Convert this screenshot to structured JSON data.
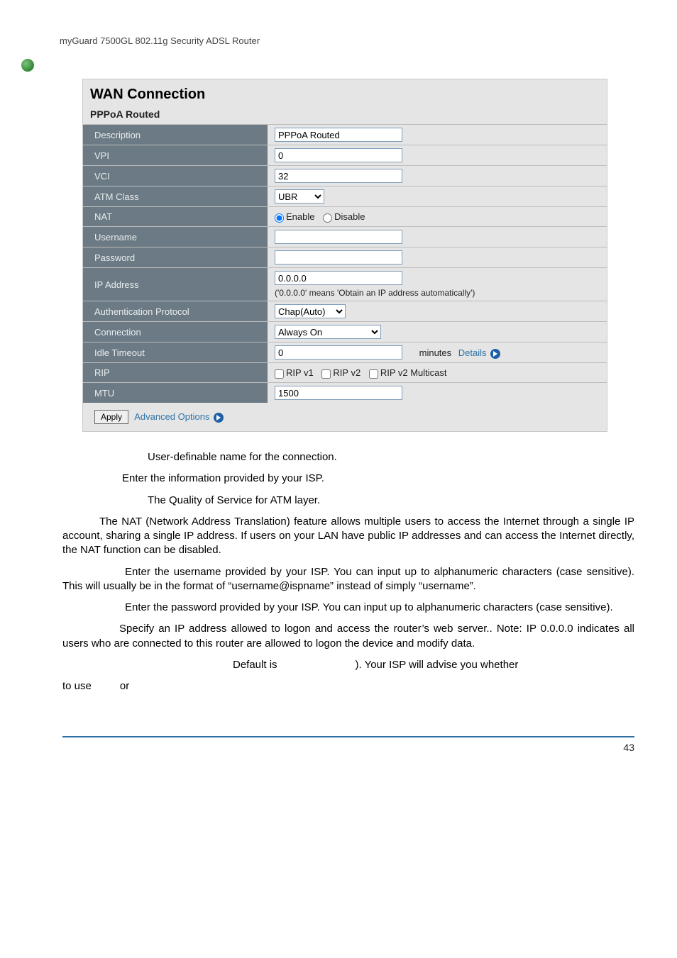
{
  "doc": {
    "header": "myGuard 7500GL 802.11g Security ADSL Router",
    "page_number": "43"
  },
  "panel": {
    "title": "WAN Connection",
    "subtitle": "PPPoA Routed",
    "labels": {
      "description": "Description",
      "vpi": "VPI",
      "vci": "VCI",
      "atm_class": "ATM Class",
      "nat": "NAT",
      "username": "Username",
      "password": "Password",
      "ip_address": "IP Address",
      "auth_protocol": "Authentication Protocol",
      "connection": "Connection",
      "idle_timeout": "Idle Timeout",
      "rip": "RIP",
      "mtu": "MTU"
    },
    "values": {
      "description": "PPPoA Routed",
      "vpi": "0",
      "vci": "32",
      "atm_class_selected": "UBR",
      "nat_enable": "Enable",
      "nat_disable": "Disable",
      "username": "",
      "password": "",
      "ip_address": "0.0.0.0",
      "ip_note": "('0.0.0.0' means 'Obtain an IP address automatically')",
      "auth_protocol_selected": "Chap(Auto)",
      "connection_selected": "Always On",
      "idle_timeout": "0",
      "idle_minutes": "minutes",
      "idle_details": "Details",
      "rip_v1": "RIP v1",
      "rip_v2": "RIP v2",
      "rip_v2m": "RIP v2 Multicast",
      "mtu": "1500"
    },
    "footer": {
      "apply": "Apply",
      "advanced": "Advanced Options"
    }
  },
  "body": {
    "p1": "User-definable name for the connection.",
    "p2": "Enter the information provided by your ISP.",
    "p3": "The Quality of Service for ATM layer.",
    "p4": "The NAT (Network Address Translation) feature allows multiple users to access the Internet through a single IP account, sharing a single IP address. If users on your LAN have public IP addresses and can access the Internet directly, the NAT function can be disabled.",
    "p5": "Enter the username provided by your ISP. You can input up to alphanumeric characters (case sensitive). This will usually be in the format of “username@ispname” instead of simply “username”.",
    "p6": "Enter the password provided by your ISP. You can input up to alphanumeric characters (case sensitive).",
    "p7": "Specify an IP address allowed to logon and access the router’s web server.. Note:  IP 0.0.0.0 indicates all users who are connected to this router are allowed to logon the device and modify data.",
    "p8a": "Default is",
    "p8b": "). Your ISP will advise you whether",
    "p9a": "to use",
    "p9b": "or"
  }
}
